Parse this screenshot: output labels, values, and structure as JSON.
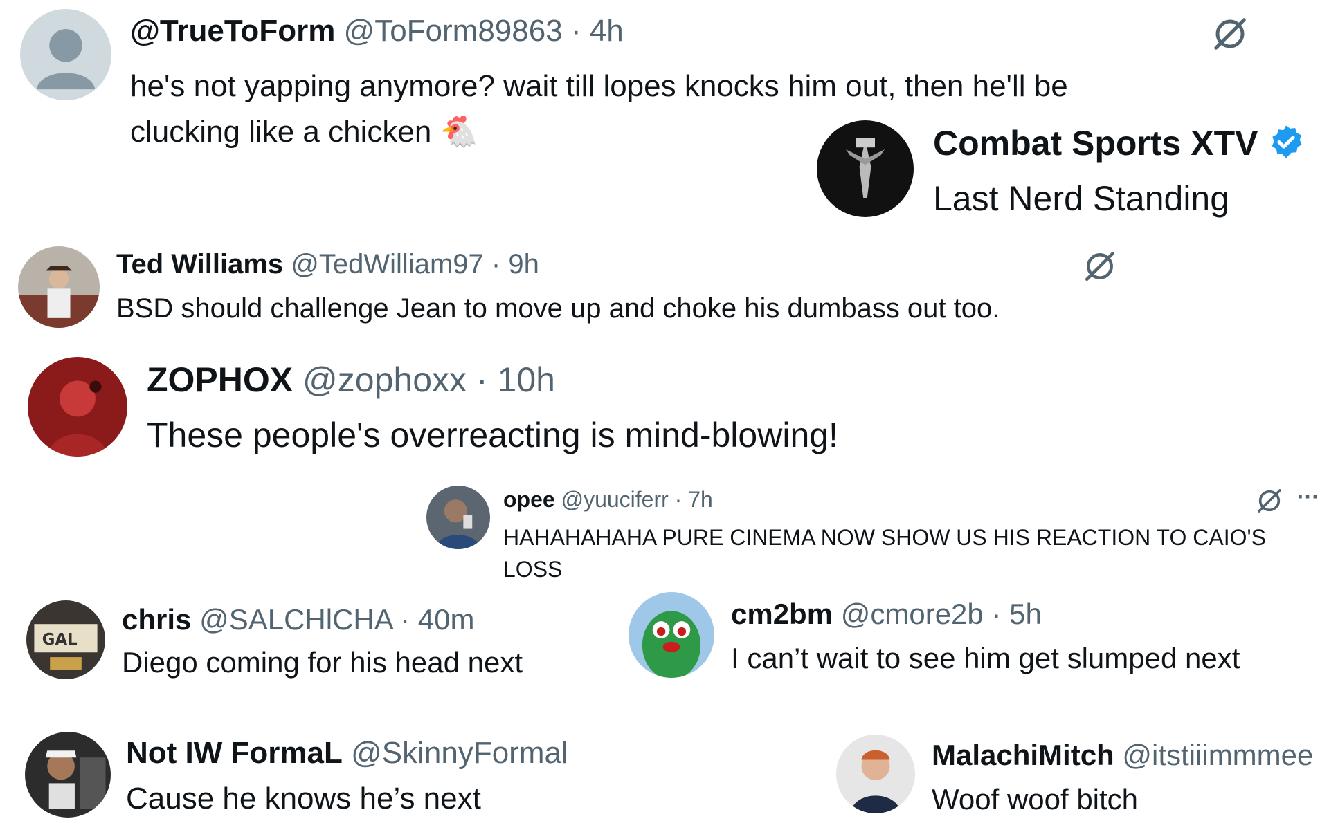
{
  "posts": [
    {
      "display_name": "@TrueToForm",
      "handle": "@ToForm89863",
      "time": "4h",
      "text_lines": [
        "he's not yapping anymore? wait till lopes knocks him out, then he'll be",
        "clucking like a chicken"
      ],
      "emoji": "🐔"
    },
    {
      "display_name": "Combat Sports XTV",
      "subtitle": "Last Nerd Standing",
      "verified": true
    },
    {
      "display_name": "Ted Williams",
      "handle": "@TedWilliam97",
      "time": "9h",
      "text": "BSD should challenge Jean to move up and choke his dumbass out too."
    },
    {
      "display_name": "ZOPHOX",
      "handle": "@zophoxx",
      "time": "10h",
      "text": "These people's overreacting is mind-blowing!"
    },
    {
      "display_name": "opee",
      "handle": "@yuuciferr",
      "time": "7h",
      "text_lines": [
        "HAHAHAHAHA PURE CINEMA NOW SHOW US HIS REACTION TO CAIO'S",
        "LOSS"
      ],
      "more": "···"
    },
    {
      "display_name": "chris",
      "handle": "@SALCHlCHA",
      "time": "40m",
      "text": "Diego coming for his head next"
    },
    {
      "display_name": "cm2bm",
      "handle": "@cmore2b",
      "time": "5h",
      "text": "I can’t wait to see him get slumped next"
    },
    {
      "display_name": "Not IW FormaL",
      "handle": "@SkinnyFormal",
      "text": "Cause he knows he’s next"
    },
    {
      "display_name": "MalachiMitch",
      "handle": "@itstiiimmmee",
      "text": "Woof woof bitch"
    }
  ],
  "separator": "·",
  "icons": {
    "grok": "grok-icon",
    "verified": "verified-badge-icon",
    "more": "more-options-icon"
  },
  "colors": {
    "text": "#0f1419",
    "meta": "#536471",
    "verified": "#1d9bf0",
    "background": "#ffffff"
  }
}
